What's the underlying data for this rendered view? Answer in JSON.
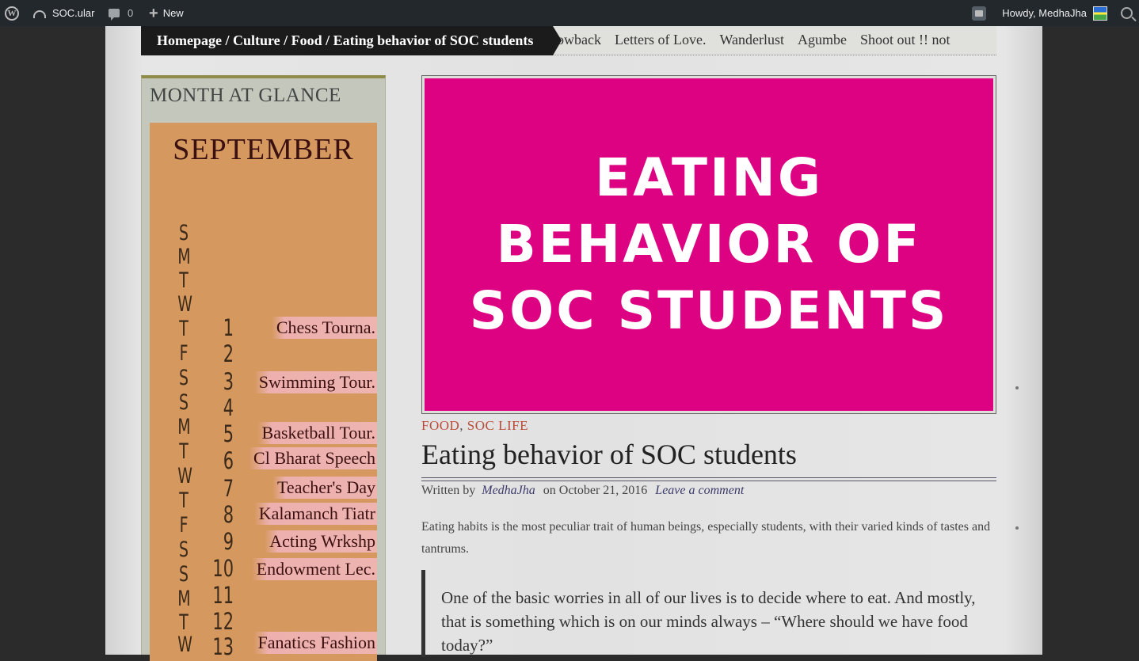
{
  "adminbar": {
    "site_name": "SOC.ular",
    "comments_count": "0",
    "new_label": "New",
    "howdy": "Howdy, MedhaJha"
  },
  "breadcrumb": "Homepage / Culture / Food / Eating behavior of SOC students",
  "nav": {
    "items": [
      "owback",
      "Letters of Love.",
      "Wanderlust",
      "Agumbe",
      "Shoot out !! not"
    ]
  },
  "sidebar": {
    "widget_title": "MONTH AT GLANCE",
    "month": "SEPTEMBER",
    "day_letters": [
      "S",
      "M",
      "T",
      "W",
      "T",
      "F",
      "S",
      "S",
      "M",
      "T",
      "W",
      "T",
      "F",
      "S",
      "S",
      "M",
      "T",
      "W"
    ],
    "days": [
      "1",
      "2",
      "3",
      "4",
      "5",
      "6",
      "7",
      "8",
      "9",
      "10",
      "11",
      "12",
      "13"
    ],
    "events": [
      "Chess Tourna.",
      "Swimming Tour.",
      "Basketball Tour.",
      "Cl Bharat Speech",
      "Teacher's Day",
      "Kalamanch Tiatr",
      "Acting Wrkshp",
      "Endowment Lec.",
      "Fanatics Fashion"
    ]
  },
  "post": {
    "featured_lines": [
      "EATING",
      "BEHAVIOR OF",
      "SOC STUDENTS"
    ],
    "category_1": "FOOD",
    "category_sep": ",",
    "category_2": "SOC LIFE",
    "title": "Eating behavior of SOC students",
    "written_by": "Written by",
    "author": "MedhaJha",
    "date": "on October 21, 2016",
    "comment_link": "Leave a comment",
    "excerpt": "Eating habits is the most peculiar trait of human beings, especially students, with their varied kinds of tastes and tantrums.",
    "quote": "One of the basic worries in all of our lives is to decide where to eat. And mostly, that is something which is on our minds always – “Where should we have food today?”"
  },
  "colors": {
    "featured_bg": "#dc0281",
    "calendar_bg": "#d5985e",
    "adminbar_bg": "#23282d"
  }
}
